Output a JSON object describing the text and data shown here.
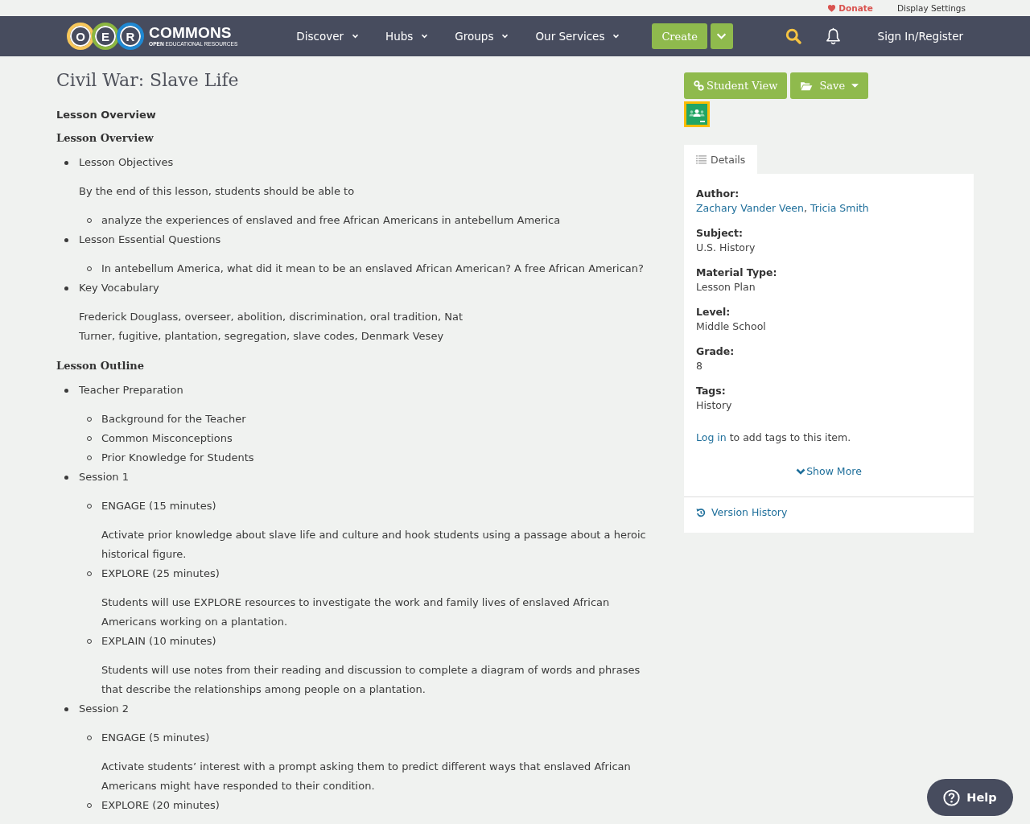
{
  "top_bar": {
    "donate": "Donate",
    "display_settings": "Display Settings"
  },
  "header": {
    "logo": {
      "letters": [
        {
          "text": "O",
          "color": "#f7c75a"
        },
        {
          "text": "E",
          "color": "#8bb640"
        },
        {
          "text": "R",
          "color": "#1f88d2"
        }
      ],
      "wordmark": "COMMONS",
      "tagline": "**OPEN** EDUCATIONAL RESOURCES"
    },
    "nav": [
      "Discover",
      "Hubs",
      "Groups",
      "Our Services"
    ],
    "create": "Create",
    "sign_in": "Sign In/Register"
  },
  "article": {
    "title": "Civil War: Slave Life",
    "label": "Lesson Overview",
    "sections": [
      {
        "heading": "Lesson Overview",
        "items": [
          {
            "text": "Lesson Objectives",
            "paragraph": "By the end of this lesson, students should be able to",
            "children": [
              {
                "text": "analyze the experiences of enslaved and free African Americans in antebellum America"
              }
            ]
          },
          {
            "text": "Lesson Essential Questions",
            "children": [
              {
                "text": "In antebellum America, what did it mean to be an enslaved African American? A free African American?"
              }
            ]
          },
          {
            "text": "Key Vocabulary",
            "paragraph": "Frederick Douglass, overseer, abolition, discrimination, oral tradition, Nat\nTurner, fugitive, plantation, segregation, slave codes, Denmark Vesey"
          }
        ]
      },
      {
        "heading": "Lesson Outline",
        "items": [
          {
            "text": "Teacher Preparation",
            "children": [
              {
                "text": "Background for the Teacher"
              },
              {
                "text": "Common Misconceptions"
              },
              {
                "text": "Prior Knowledge for Students"
              }
            ]
          },
          {
            "text": "Session 1",
            "children": [
              {
                "text": "ENGAGE (15 minutes)",
                "paragraph": "Activate prior knowledge about slave life and culture and hook students using a passage about a heroic historical figure."
              },
              {
                "text": "EXPLORE (25 minutes)",
                "paragraph": "Students will use EXPLORE resources to investigate the work and family lives of enslaved African Americans working on a plantation."
              },
              {
                "text": "EXPLAIN (10 minutes)",
                "paragraph": "Students will use notes from their reading and discussion to complete a diagram of words and phrases that describe the relationships among people on a plantation."
              }
            ]
          },
          {
            "text": "Session 2",
            "children": [
              {
                "text": "ENGAGE (5 minutes)",
                "paragraph": "Activate students’ interest with a prompt asking them to predict different ways that enslaved African Americans might have responded to their condition."
              },
              {
                "text": "EXPLORE (20 minutes)"
              }
            ]
          }
        ]
      }
    ]
  },
  "actions": {
    "student_view": "Student View",
    "save": "Save"
  },
  "details": {
    "tab": {
      "label": "Details",
      "selected": true
    },
    "fields": [
      {
        "label": "Author:",
        "kind": "links",
        "values": [
          "Zachary Vander Veen",
          "Tricia Smith"
        ],
        "separator": ","
      },
      {
        "label": "Subject:",
        "kind": "text",
        "values": [
          "U.S. History"
        ]
      },
      {
        "label": "Material Type:",
        "kind": "text",
        "values": [
          "Lesson Plan"
        ]
      },
      {
        "label": "Level:",
        "kind": "text",
        "values": [
          "Middle School"
        ]
      },
      {
        "label": "Grade:",
        "kind": "text",
        "values": [
          "8"
        ]
      },
      {
        "label": "Tags:",
        "kind": "text",
        "values": [
          "History"
        ]
      }
    ],
    "login_note": {
      "link": "Log in",
      "rest": "to add tags to this item."
    },
    "show_more": "Show More",
    "version_history": "Version History"
  },
  "help": "Help"
}
